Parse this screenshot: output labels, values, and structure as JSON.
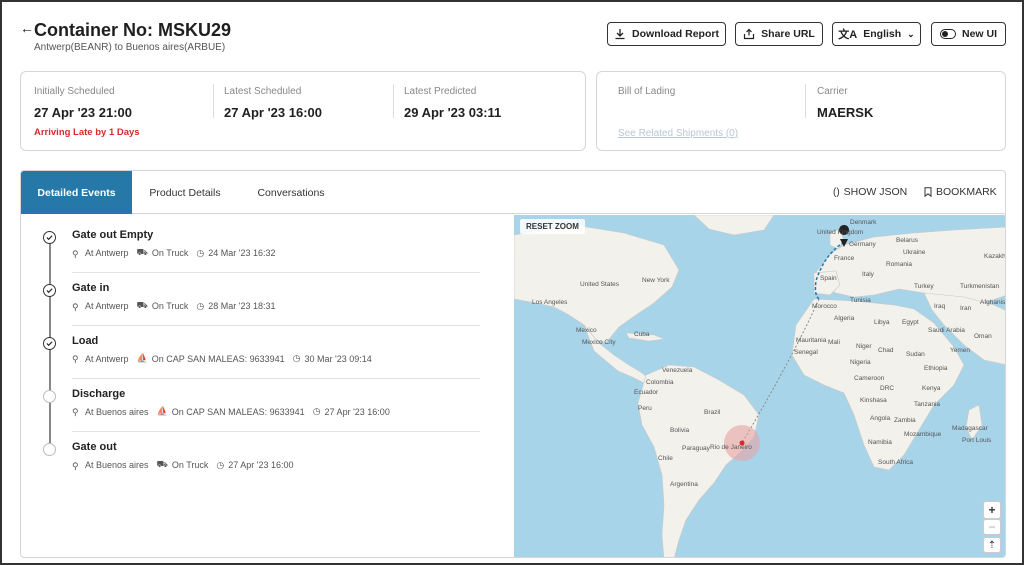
{
  "header": {
    "title": "Container No: MSKU29",
    "subtitle": "Antwerp(BEANR) to Buenos aires(ARBUE)",
    "buttons": {
      "download": "Download Report",
      "share": "Share URL",
      "language": "English",
      "newui": "New UI"
    }
  },
  "schedule": {
    "initially_label": "Initially Scheduled",
    "initially_value": "27 Apr '23 21:00",
    "late_text": "Arriving Late by 1 Days",
    "latest_label": "Latest Scheduled",
    "latest_value": "27 Apr '23 16:00",
    "predicted_label": "Latest Predicted",
    "predicted_value": "29 Apr '23 03:11"
  },
  "bol": {
    "bill_label": "Bill of Lading",
    "bill_value": "",
    "carrier_label": "Carrier",
    "carrier_value": "MAERSK",
    "related_link": "See Related Shipments (0)"
  },
  "tabs": [
    {
      "label": "Detailed Events",
      "active": true
    },
    {
      "label": "Product Details"
    },
    {
      "label": "Conversations"
    }
  ],
  "actions": {
    "json": "SHOW JSON",
    "bookmark": "BOOKMARK"
  },
  "events": [
    {
      "title": "Gate out Empty",
      "location": "At Antwerp",
      "mode": "On Truck",
      "time": "24 Mar '23 16:32",
      "done": true
    },
    {
      "title": "Gate in",
      "location": "At Antwerp",
      "mode": "On Truck",
      "time": "28 Mar '23 18:31",
      "done": true
    },
    {
      "title": "Load",
      "location": "At Antwerp",
      "mode": "On CAP SAN MALEAS: 9633941",
      "time": "30 Mar '23 09:14",
      "done": true
    },
    {
      "title": "Discharge",
      "location": "At Buenos aires",
      "mode": "On CAP SAN MALEAS: 9633941",
      "time": "27 Apr '23 16:00",
      "done": false
    },
    {
      "title": "Gate out",
      "location": "At Buenos aires",
      "mode": "On Truck",
      "time": "27 Apr '23 16:00",
      "done": false
    }
  ],
  "map": {
    "reset_zoom": "RESET ZOOM",
    "zoom_in": "+",
    "zoom_out": "−",
    "compass": "⇡",
    "labels": {
      "denmark": "Denmark",
      "uk": "United Kingdom",
      "germany": "Germany",
      "belarus": "Belarus",
      "ukraine": "Ukraine",
      "kazakh": "Kazakh",
      "france": "France",
      "romania": "Romania",
      "italy": "Italy",
      "spain": "Spain",
      "turkey": "Turkey",
      "turkmenistan": "Turkmenistan",
      "usa": "United States",
      "newyork": "New York",
      "la": "Los Angeles",
      "morocco": "Morocco",
      "tunisia": "Tunisia",
      "algeria": "Algeria",
      "libya": "Libya",
      "egypt": "Egypt",
      "saudi": "Saudi Arabia",
      "iraq": "Iraq",
      "iran": "Iran",
      "afghanis": "Afghanis",
      "oman": "Oman",
      "mexico": "Mexico",
      "mexicocity": "Mexico City",
      "cuba": "Cuba",
      "mauritania": "Mauritania",
      "mali": "Mali",
      "niger": "Niger",
      "chad": "Chad",
      "sudan": "Sudan",
      "senegal": "Senegal",
      "yemen": "Yemen",
      "nigeria": "Nigeria",
      "ethiopia": "Ethiopia",
      "venezuela": "Venezuela",
      "colombia": "Colombia",
      "ecuador": "Ecuador",
      "cameroon": "Cameroon",
      "kenya": "Kenya",
      "drc": "DRC",
      "tanzania": "Tanzania",
      "kinshasa": "Kinshasa",
      "peru": "Peru",
      "brazil": "Brazil",
      "angola": "Angola",
      "bolivia": "Bolivia",
      "zambia": "Zambia",
      "mozambique": "Mozambique",
      "madagascar": "Madagascar",
      "namibia": "Namibia",
      "paraguay": "Paraguay",
      "rio": "Rio de Janeiro",
      "chile": "Chile",
      "southafrica": "South Africa",
      "argentina": "Argentina",
      "portlouis": "Port Louis"
    }
  },
  "colors": {
    "accent": "#2678a8",
    "late": "#d62b2b",
    "water": "#a8d4ea",
    "land": "#f2f1ec"
  }
}
